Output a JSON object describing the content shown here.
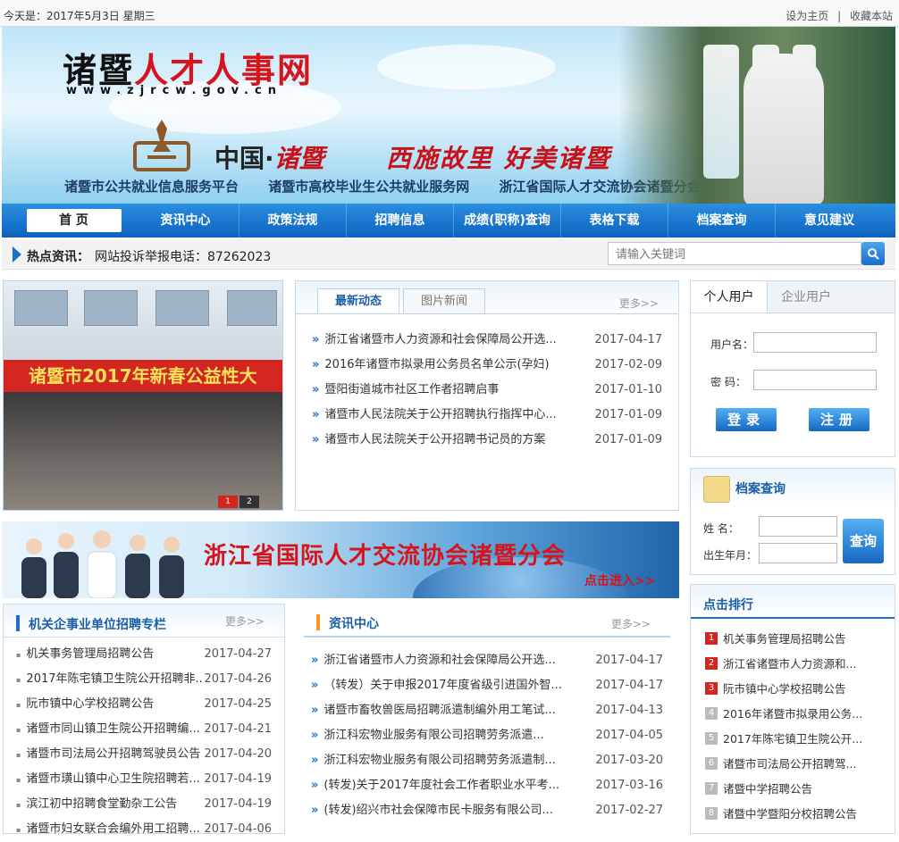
{
  "topbar": {
    "date": "今天是：2017年5月3日  星期三",
    "set_home": "设为主页",
    "sep": "|",
    "bookmark": "收藏本站"
  },
  "banner": {
    "title_a": "诸暨",
    "title_b": "人才人事网",
    "url": "www.zjrcw.gov.cn",
    "slogan_a": "中国·",
    "slogan_b": "诸暨",
    "slogan_c": "西施故里  好美诸暨",
    "platforms": [
      "诸暨市公共就业信息服务平台",
      "诸暨市高校毕业生公共就业服务网",
      "浙江省国际人才交流协会诸暨分会"
    ]
  },
  "nav": [
    "首  页",
    "资讯中心",
    "政策法规",
    "招聘信息",
    "成绩(职称)查询",
    "表格下载",
    "档案查询",
    "意见建议"
  ],
  "hot": {
    "label": "热点资讯：",
    "text": "网站投诉举报电话：87262023"
  },
  "search": {
    "placeholder": "请输入关键词",
    "icon": "search-icon"
  },
  "photo": {
    "banner_text": "诸暨市2017年新春公益性大",
    "pages": [
      "1",
      "2"
    ]
  },
  "news": {
    "tabs": [
      "最新动态",
      "图片新闻"
    ],
    "more": "更多>>",
    "items": [
      {
        "t": "浙江省诸暨市人力资源和社会保障局公开选...",
        "d": "2017-04-17"
      },
      {
        "t": "2016年诸暨市拟录用公务员名单公示(孕妇)",
        "d": "2017-02-09"
      },
      {
        "t": "暨阳街道城市社区工作者招聘启事",
        "d": "2017-01-10"
      },
      {
        "t": "诸暨市人民法院关于公开招聘执行指挥中心...",
        "d": "2017-01-09"
      },
      {
        "t": "诸暨市人民法院关于公开招聘书记员的方案",
        "d": "2017-01-09"
      }
    ]
  },
  "login": {
    "tabs": [
      "个人用户",
      "企业用户"
    ],
    "user_label": "用户名：",
    "pwd_label": "密  码：",
    "login": "登录",
    "register": "注册"
  },
  "archive": {
    "title": "档案查询",
    "name_label": "姓    名：",
    "birth_label": "出生年月：",
    "query": "查询"
  },
  "ad": {
    "headline": "浙江省国际人才交流协会诸暨分会",
    "enter": "点击进入>>"
  },
  "recruit": {
    "title": "机关企事业单位招聘专栏",
    "more": "更多>>",
    "items": [
      {
        "t": "机关事务管理局招聘公告",
        "d": "2017-04-27"
      },
      {
        "t": "2017年陈宅镇卫生院公开招聘非...",
        "d": "2017-04-26"
      },
      {
        "t": "阮市镇中心学校招聘公告",
        "d": "2017-04-25"
      },
      {
        "t": "诸暨市同山镇卫生院公开招聘编...",
        "d": "2017-04-21"
      },
      {
        "t": "诸暨市司法局公开招聘驾驶员公告",
        "d": "2017-04-20"
      },
      {
        "t": "诸暨市璜山镇中心卫生院招聘若...",
        "d": "2017-04-19"
      },
      {
        "t": "滨江初中招聘食堂勤杂工公告",
        "d": "2017-04-19"
      },
      {
        "t": "诸暨市妇女联合会编外用工招聘...",
        "d": "2017-04-06"
      }
    ]
  },
  "info": {
    "title": "资讯中心",
    "more": "更多>>",
    "items": [
      {
        "t": "浙江省诸暨市人力资源和社会保障局公开选...",
        "d": "2017-04-17"
      },
      {
        "t": "（转发）关于申报2017年度省级引进国外智...",
        "d": "2017-04-17"
      },
      {
        "t": "诸暨市畜牧兽医局招聘派遣制编外用工笔试...",
        "d": "2017-04-13"
      },
      {
        "t": "浙江科宏物业服务有限公司招聘劳务派遣...",
        "d": "2017-04-05"
      },
      {
        "t": "浙江科宏物业服务有限公司招聘劳务派遣制...",
        "d": "2017-03-20"
      },
      {
        "t": "(转发)关于2017年度社会工作者职业水平考...",
        "d": "2017-03-16"
      },
      {
        "t": "(转发)绍兴市社会保障市民卡服务有限公司...",
        "d": "2017-02-27"
      }
    ]
  },
  "rank": {
    "title": "点击排行",
    "items": [
      {
        "n": "1",
        "t": "机关事务管理局招聘公告"
      },
      {
        "n": "2",
        "t": "浙江省诸暨市人力资源和..."
      },
      {
        "n": "3",
        "t": "阮市镇中心学校招聘公告"
      },
      {
        "n": "4",
        "t": "2016年诸暨市拟录用公务..."
      },
      {
        "n": "5",
        "t": "2017年陈宅镇卫生院公开..."
      },
      {
        "n": "6",
        "t": "诸暨市司法局公开招聘驾..."
      },
      {
        "n": "7",
        "t": "诸暨中学招聘公告"
      },
      {
        "n": "8",
        "t": "诸暨中学暨阳分校招聘公告"
      }
    ]
  }
}
